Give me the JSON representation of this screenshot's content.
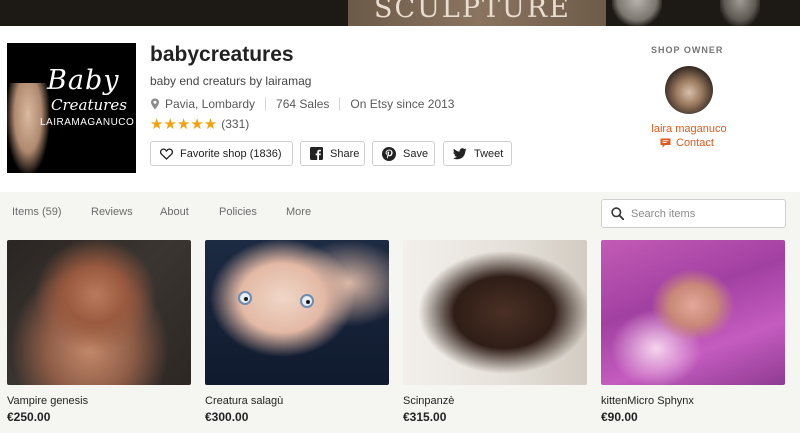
{
  "banner": {
    "text": "SCULPTURE"
  },
  "shop": {
    "logo_line1": "Baby",
    "logo_line2": "Creatures",
    "logo_line3": "LAIRAMAGANUCO",
    "name": "babycreatures",
    "tagline": "baby end creaturs by lairamag",
    "location": "Pavia, Lombardy",
    "sales": "764 Sales",
    "since": "On Etsy since 2013",
    "rating_stars": "★★★★★",
    "rating_value": 5,
    "rating_count": "(331)"
  },
  "actions": {
    "favorite_label": "Favorite shop (1836)",
    "share_label": "Share",
    "save_label": "Save",
    "tweet_label": "Tweet"
  },
  "owner": {
    "heading": "SHOP OWNER",
    "name": "laira maganuco",
    "contact_label": "Contact"
  },
  "nav": {
    "items": [
      "Items (59)",
      "Reviews",
      "About",
      "Policies",
      "More"
    ]
  },
  "search": {
    "placeholder": "Search items",
    "value": ""
  },
  "listings": [
    {
      "title": "Vampire genesis",
      "price": "€250.00"
    },
    {
      "title": "Creatura salagù",
      "price": "€300.00"
    },
    {
      "title": "Scinpanzè",
      "price": "€315.00"
    },
    {
      "title": "kittenMicro Sphynx",
      "price": "€90.00"
    }
  ],
  "colors": {
    "accent": "#e0591c",
    "star": "#f1a20d",
    "nav_bg": "#f5f5f1"
  },
  "icons": {
    "location": "map-pin-icon",
    "favorite": "heart-icon",
    "share": "facebook-icon",
    "save": "pinterest-icon",
    "tweet": "twitter-icon",
    "contact": "message-icon",
    "search": "search-icon"
  }
}
